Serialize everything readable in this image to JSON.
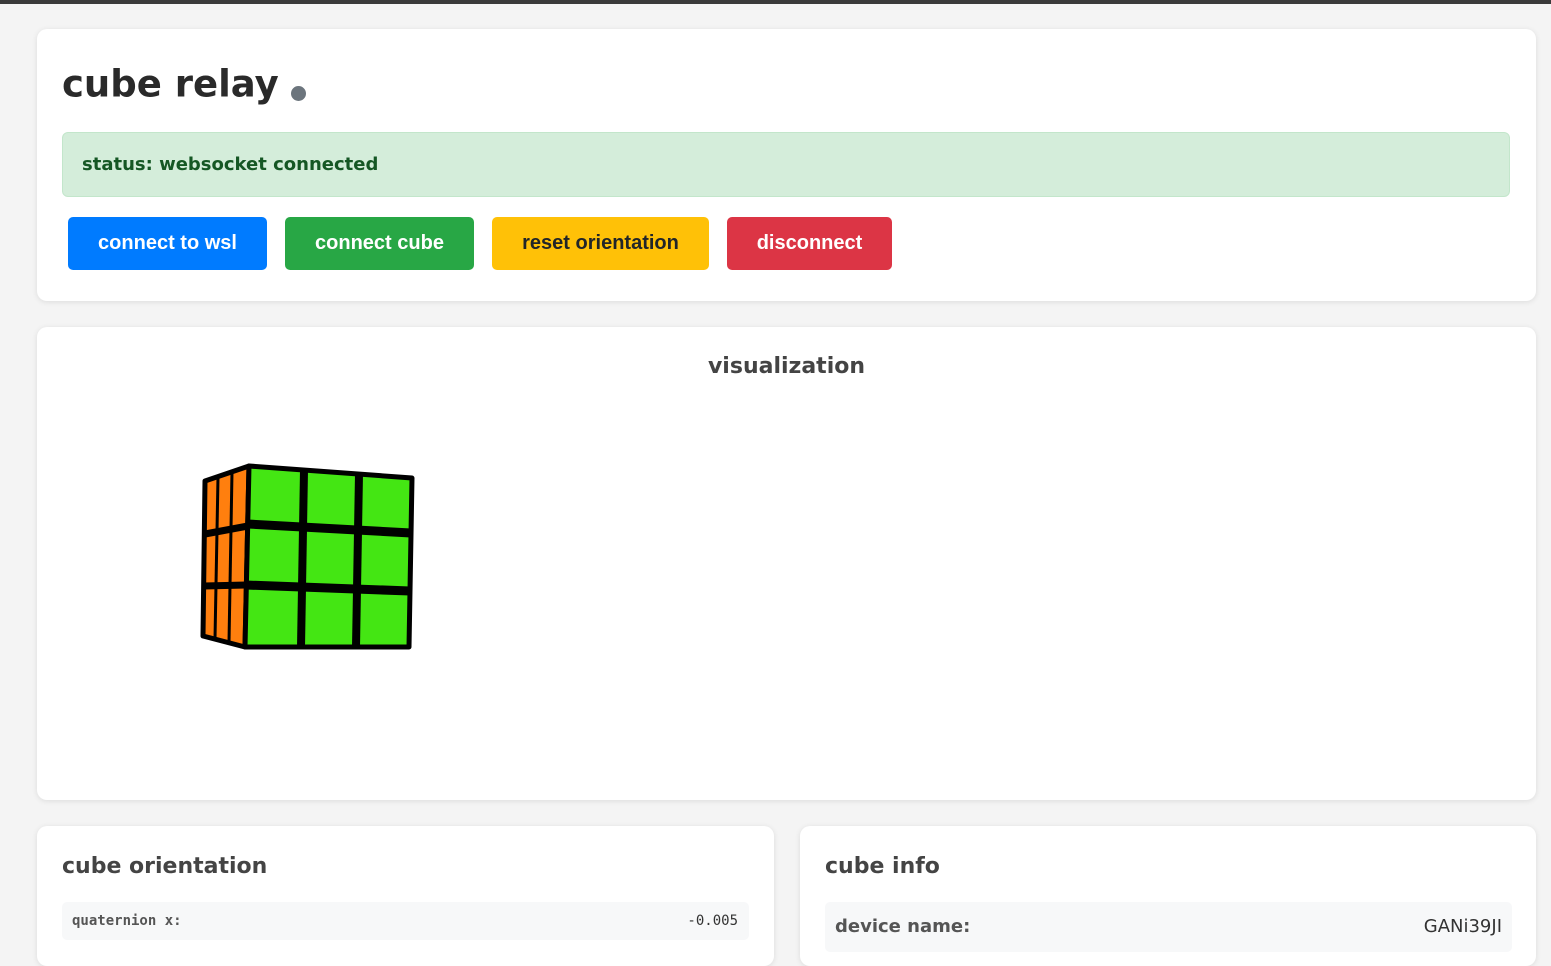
{
  "app": {
    "title": "cube relay",
    "status_text": "status: websocket connected"
  },
  "buttons": {
    "connect_wsl": "connect to wsl",
    "connect_cube": "connect cube",
    "reset_orientation": "reset orientation",
    "disconnect": "disconnect"
  },
  "colors": {
    "connect_wsl": "#007bff",
    "connect_cube": "#28a745",
    "reset_orientation": "#ffc107",
    "disconnect": "#dc3545",
    "status_bg": "#d4edda",
    "status_text": "#155724",
    "indicator_dot": "#6c757d",
    "cube_front_face": "#44e613",
    "cube_side_face": "#ff7f0e",
    "cube_grid": "#000000"
  },
  "visualization": {
    "heading": "visualization",
    "cube": {
      "front_face_color": "green",
      "side_face_color": "orange",
      "grid": "3x3"
    }
  },
  "orientation": {
    "heading": "cube orientation",
    "rows": [
      {
        "label": "quaternion x:",
        "value": "-0.005"
      }
    ]
  },
  "info": {
    "heading": "cube info",
    "rows": [
      {
        "label": "device name:",
        "value": "GANi39JI"
      }
    ]
  }
}
